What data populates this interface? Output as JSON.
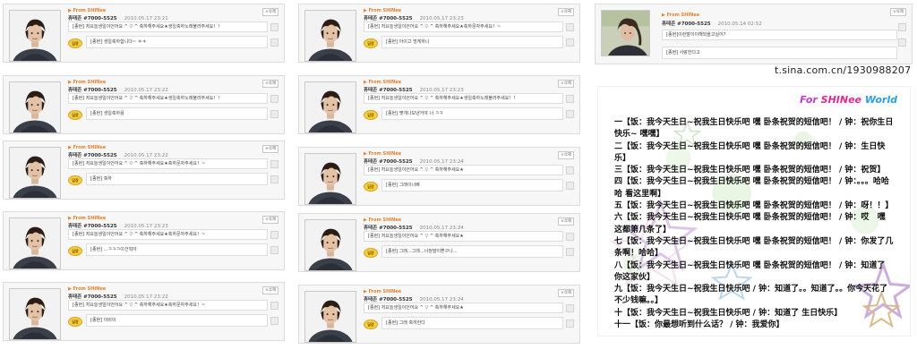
{
  "common": {
    "from_label": "▶ From SHINee",
    "sender": "휴태존 #7000-5525",
    "delete_label": "×삭제",
    "reply_badge": "답장"
  },
  "cards": [
    {
      "id": "c1",
      "time": "2010.05.17 23:21",
      "message": "[종현] 저요늘생일이언어요 ^ ▽ ^  축하해주세요★생일축하노래불러주세요！！",
      "reply": "[종현] 생일축하합니다~ ＊＊"
    },
    {
      "id": "c2",
      "time": "2010.05.17 23:22",
      "message": "[종현] 저요늘생일이언어요 ^ ▽ ^  축하해주세요★생일축하노래불러주세요！！",
      "reply": "[종현] 생일축하용"
    },
    {
      "id": "c3",
      "time": "2010.05.17 23:22",
      "message": "[종현] 저요늘생일이언어요 ^ ▽ ^  축하해주세요★축하문자주세요！~",
      "reply": "[종현] 축하"
    },
    {
      "id": "c4",
      "time": "2010.05.17 23:23",
      "message": "[종현] 저요늘생일이언어요 ^ ▽ ^  축하해주세요★축하문자주세요！~",
      "reply": "[종현] ...ㅋㅋㅋ이건뭐야"
    },
    {
      "id": "c5",
      "time": "2010.05.17 23:22",
      "message": "[종현] 저요늘생일이언어요 ^ ▽ ^  축하해주세요★축하문자주세요！~",
      "reply": "[종현] 이비이"
    },
    {
      "id": "c6",
      "time": "2010.05.17 23:23",
      "message": "[종현] 저요늘생일이언어요 ^ ▽ ^  축하해주세요★축하문자주세요！~",
      "reply": "[종현] 아이고 멍게하니"
    },
    {
      "id": "c7",
      "time": "2010.05.17 23:23",
      "message": "[종현] 저요늘생일이언어요 ^ ▽ ^  축하해주세요★생일축하노래불러주세요！！",
      "reply": "[종현] 몇개나보낸거야 너 ㅋㅋ"
    },
    {
      "id": "c8",
      "time": "2010.05.17 23:24",
      "message": "[종현] 저요늘생일이언어요 ^ ▽ ^  축하해주세요★",
      "reply": "[종현] 그래이너삐"
    },
    {
      "id": "c9",
      "time": "2010.05.17 23:24",
      "message": "[종현] 저요늘생일이언어요 ^ ▽ ^  축하해주세요★",
      "reply": "[종현] 그래...그래...너정말이쁜구나..."
    },
    {
      "id": "c10",
      "time": "2010.05.17 23:24",
      "message": "[종현] 저요늘생일이언어요 ^ ▽ ^  축하해주세요★",
      "reply": "[종현] 그래 축하한다"
    },
    {
      "id": "c11",
      "time": "2010.05.14 02:52",
      "message": "[종현]이런말이이해되을고실어?",
      "reply": "[종현] 사랑한다고"
    }
  ],
  "watermark": "t.sina.com.cn/1930988207",
  "panel": {
    "title_a": "For ",
    "title_b": "SHINee",
    "title_c": " World",
    "lines": [
      "一【饭：我今天生日~祝我生日快乐吧 嘿 卧条祝贺的短信吧！ / 钟：祝你生日快乐~ 嘿嘿】",
      "二【饭：我今天生日~祝我生日快乐吧 嘿 卧条祝贺的短信吧！ / 钟：生日快乐】",
      "三【饭：我今天生日~祝我生日快乐吧 嘿 卧条祝贺的短信吧！ / 钟：祝贺】",
      "四【饭：我今天生日~祝我生日快乐吧 嘿 卧条祝贺的短信吧！ / 钟：。。。哈哈哈 看这里啊】",
      "五【饭：我今天生日~祝我生日快乐吧 嘿 卧条祝贺的短信吧！ / 钟：呀！！】",
      "六【饭：我今天生日~祝我生日快乐吧 嘿 卧条祝贺的短信吧！ / 钟：哎   嘿  这都第几条了】",
      "七【饭：我今天生日~祝我生日快乐吧 嘿 卧条祝贺的短信吧！ / 钟：你发了几条啊！哈哈】",
      "八【饭：我今天生日~祝我生日快乐吧 嘿 卧条祝贺的短信吧！ / 钟：知道了  你这家伙】",
      "九【饭：我今天生日~祝我生日快乐吧 / 钟：知道了。。知道了。。你今天花了不少钱嘛。。】",
      "十【饭：我今天生日~祝我生日快乐吧 / 钟：知道了 生日快乐】",
      "十一【饭：你最想听到什么话？ / 钟：我爱你】"
    ]
  }
}
